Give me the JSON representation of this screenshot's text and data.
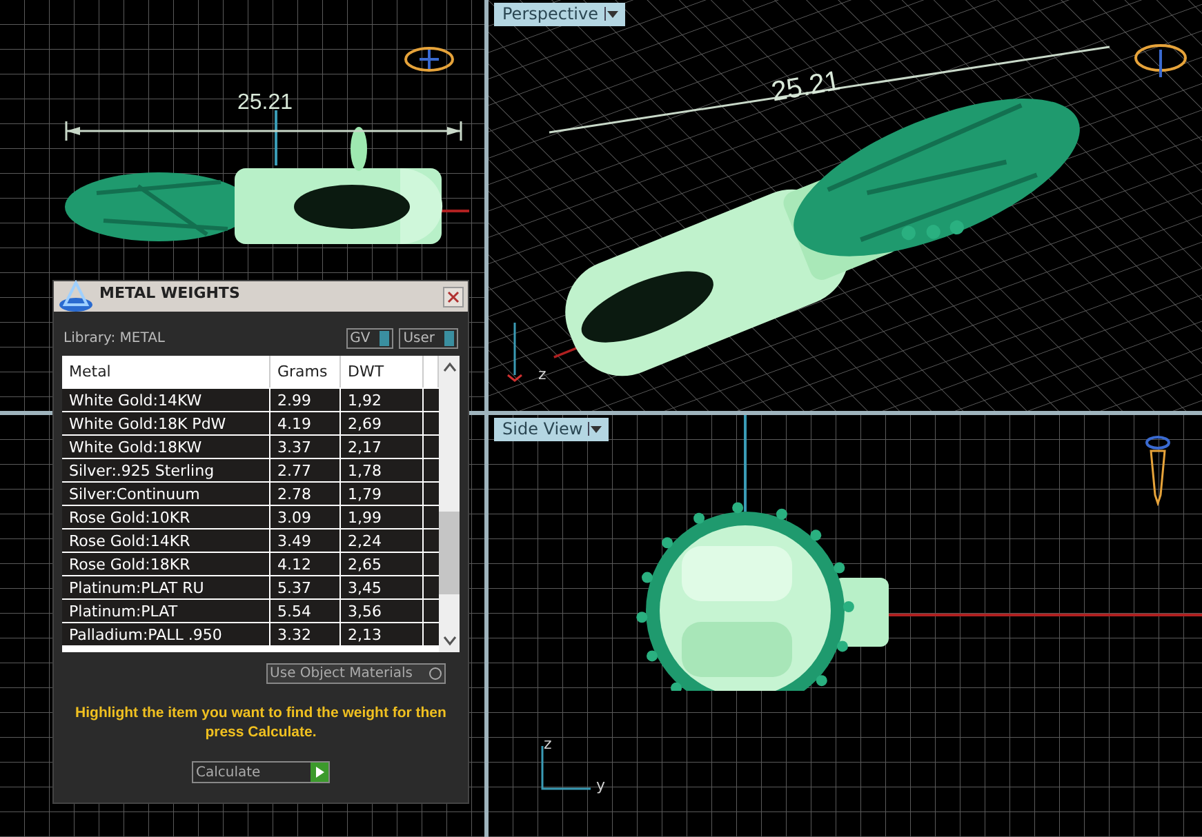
{
  "viewports": [
    {
      "kind": "top",
      "dimension": "25.21"
    },
    {
      "kind": "perspective",
      "label": "Perspective",
      "dimension": "25.21",
      "axes": [
        "z"
      ]
    },
    {
      "kind": "front"
    },
    {
      "kind": "side",
      "label": "Side View",
      "axes": [
        "z",
        "y"
      ]
    }
  ],
  "dialog": {
    "title": "METAL WEIGHTS",
    "library": "Library: METAL",
    "toggles": [
      {
        "label": "GV",
        "on": true
      },
      {
        "label": "User",
        "on": true
      }
    ],
    "columns": [
      "Metal",
      "Grams",
      "DWT"
    ],
    "rows": [
      {
        "metal": "White Gold:14KW",
        "grams": "2.99",
        "dwt": "1,92"
      },
      {
        "metal": "White Gold:18K PdW",
        "grams": "4.19",
        "dwt": "2,69"
      },
      {
        "metal": "White Gold:18KW",
        "grams": "3.37",
        "dwt": "2,17"
      },
      {
        "metal": "Silver:.925 Sterling",
        "grams": "2.77",
        "dwt": "1,78"
      },
      {
        "metal": "Silver:Continuum",
        "grams": "2.78",
        "dwt": "1,79"
      },
      {
        "metal": "Rose Gold:10KR",
        "grams": "3.09",
        "dwt": "1,99"
      },
      {
        "metal": "Rose Gold:14KR",
        "grams": "3.49",
        "dwt": "2,24"
      },
      {
        "metal": "Rose Gold:18KR",
        "grams": "4.12",
        "dwt": "2,65"
      },
      {
        "metal": "Platinum:PLAT RU",
        "grams": "5.37",
        "dwt": "3,45"
      },
      {
        "metal": "Platinum:PLAT",
        "grams": "5.54",
        "dwt": "3,56"
      },
      {
        "metal": "Palladium:PALL .950",
        "grams": "3.32",
        "dwt": "2,13"
      }
    ],
    "use_object_materials": {
      "label": "Use Object Materials",
      "checked": false
    },
    "message": "Highlight the item you want to find the weight for then press Calculate.",
    "button": "Calculate"
  }
}
